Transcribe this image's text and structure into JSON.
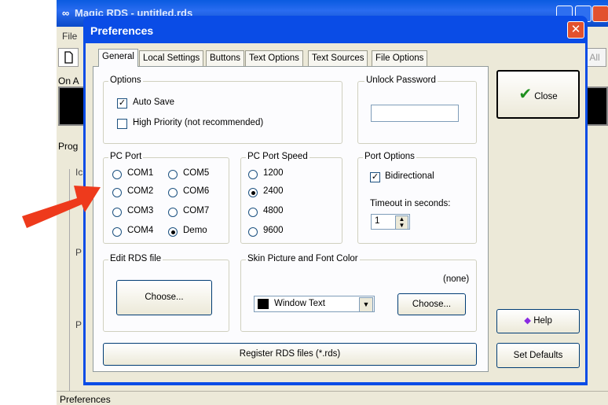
{
  "background_app": {
    "title": "Magic RDS - untitled.rds",
    "menu_file": "File",
    "toolbar_all": "All",
    "on_air_label": "On A",
    "prog_label": "Prog",
    "side_letters": [
      "Ic",
      "P",
      "P"
    ],
    "status_text": "Preferences"
  },
  "dialog": {
    "title": "Preferences",
    "close_glyph": "✕",
    "tabs": [
      "General",
      "Local Settings",
      "Buttons",
      "Text Options",
      "Text Sources",
      "File Options"
    ],
    "options": {
      "label": "Options",
      "auto_save": "Auto Save",
      "auto_save_checked": true,
      "high_priority": "High Priority (not recommended)",
      "high_priority_checked": false
    },
    "unlock_password": {
      "label": "Unlock Password",
      "value": ""
    },
    "pc_port": {
      "label": "PC Port",
      "ports": [
        "COM1",
        "COM2",
        "COM3",
        "COM4",
        "COM5",
        "COM6",
        "COM7",
        "Demo"
      ],
      "selected": "Demo"
    },
    "pc_port_speed": {
      "label": "PC Port Speed",
      "speeds": [
        "1200",
        "2400",
        "4800",
        "9600"
      ],
      "selected": "2400"
    },
    "port_options": {
      "label": "Port Options",
      "bidirectional": "Bidirectional",
      "bidirectional_checked": true,
      "timeout_label": "Timeout in seconds:",
      "timeout_value": "1"
    },
    "edit_rds": {
      "label": "Edit RDS file",
      "choose": "Choose..."
    },
    "skin": {
      "label": "Skin Picture and Font Color",
      "picture": "(none)",
      "color_value": "Window Text",
      "swatch_color": "#000000",
      "choose": "Choose..."
    },
    "register_button": "Register RDS files (*.rds)",
    "close_button": "Close",
    "help_button": "Help",
    "set_defaults_button": "Set Defaults"
  },
  "colors": {
    "xp_blue": "#0a4ce6",
    "close_red": "#e2512d",
    "arrow_red": "#ee3a1c",
    "check_green": "#1e8f1e"
  }
}
